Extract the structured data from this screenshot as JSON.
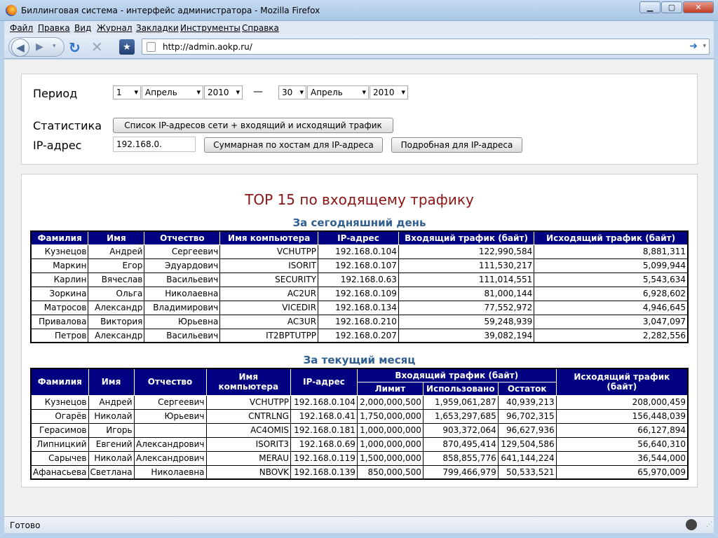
{
  "window": {
    "title": "Биллинговая система - интерфейс администратора - Mozilla Firefox"
  },
  "menu": [
    "Файл",
    "Правка",
    "Вид",
    "Журнал",
    "Закладки",
    "Инструменты",
    "Справка"
  ],
  "nav": {
    "url": "http://admin.aokp.ru/"
  },
  "form": {
    "period_label": "Период",
    "from_day": "1",
    "from_month": "Апрель",
    "from_year": "2010",
    "dash": "—",
    "to_day": "30",
    "to_month": "Апрель",
    "to_year": "2010",
    "stats_label": "Статистика",
    "stats_button": "Список IP-адресов сети  +   входящий и исходящий трафик",
    "ip_label": "IP-адрес",
    "ip_value": "192.168.0.",
    "summary_button": "Суммарная по хостам для IP-адреса",
    "detail_button": "Подробная для IP-адреса"
  },
  "report": {
    "title": "TOP 15 по входящему трафику",
    "today_title": "За сегодняшний день",
    "month_title": "За текущий месяц"
  },
  "today_table": {
    "headers": [
      "Фамилия",
      "Имя",
      "Отчество",
      "Имя компьютера",
      "IP-адрес",
      "Входящий трафик (байт)",
      "Исходящий трафик (байт)"
    ],
    "rows": [
      [
        "Кузнецов",
        "Андрей",
        "Сергеевич",
        "VCHUTPP",
        "192.168.0.104",
        "122,990,584",
        "8,881,311"
      ],
      [
        "Маркин",
        "Егор",
        "Эдуардович",
        "ISORIT",
        "192.168.0.107",
        "111,530,217",
        "5,099,944"
      ],
      [
        "Карлин",
        "Вячеслав",
        "Васильевич",
        "SECURITY",
        "192.168.0.63",
        "111,014,551",
        "5,543,634"
      ],
      [
        "Зоркина",
        "Ольга",
        "Николаевна",
        "AC2UR",
        "192.168.0.109",
        "81,000,144",
        "6,928,602"
      ],
      [
        "Матросов",
        "Александр",
        "Владимирович",
        "VICEDIR",
        "192.168.0.134",
        "77,552,972",
        "4,946,645"
      ],
      [
        "Привалова",
        "Виктория",
        "Юрьевна",
        "AC3UR",
        "192.168.0.210",
        "59,248,939",
        "3,047,097"
      ],
      [
        "Петров",
        "Александр",
        "Васильевич",
        "IT2BPTUTPP",
        "192.168.0.207",
        "39,082,194",
        "2,282,556"
      ]
    ]
  },
  "month_table": {
    "headers": {
      "last": "Фамилия",
      "first": "Имя",
      "middle": "Отчество",
      "computer": "Имя компьютера",
      "ip": "IP-адрес",
      "incoming": "Входящий трафик (байт)",
      "limit": "Лимит",
      "used": "Использовано",
      "remaining": "Остаток",
      "outgoing": "Исходящий трафик (байт)"
    },
    "rows": [
      [
        "Кузнецов",
        "Андрей",
        "Сергеевич",
        "VCHUTPP",
        "192.168.0.104",
        "2,000,000,500",
        "1,959,061,287",
        "40,939,213",
        "208,000,459"
      ],
      [
        "Огарёв",
        "Николай",
        "Юрьевич",
        "CNTRLNG",
        "192.168.0.41",
        "1,750,000,000",
        "1,653,297,685",
        "96,702,315",
        "156,448,039"
      ],
      [
        "Герасимов",
        "Игорь",
        "",
        "AC4OMIS",
        "192.168.0.181",
        "1,000,000,000",
        "903,372,064",
        "96,627,936",
        "66,127,894"
      ],
      [
        "Липницкий",
        "Евгений",
        "Александрович",
        "ISORIT3",
        "192.168.0.69",
        "1,000,000,000",
        "870,495,414",
        "129,504,586",
        "56,640,310"
      ],
      [
        "Сарычев",
        "Николай",
        "Александрович",
        "MERAU",
        "192.168.0.119",
        "1,500,000,000",
        "858,855,776",
        "641,144,224",
        "36,544,000"
      ],
      [
        "Афанасьева",
        "Светлана",
        "Николаевна",
        "NBOVK",
        "192.168.0.139",
        "850,000,500",
        "799,466,979",
        "50,533,521",
        "65,970,009"
      ]
    ]
  },
  "status": {
    "text": "Готово"
  }
}
